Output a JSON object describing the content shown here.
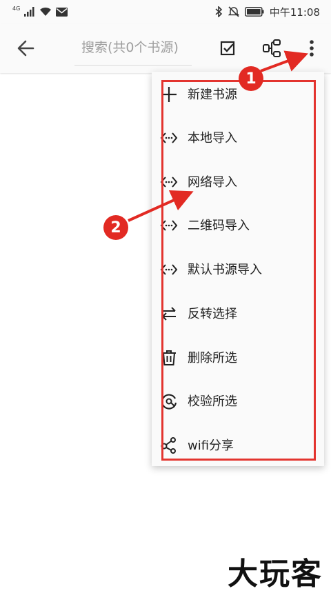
{
  "status_bar": {
    "network_label": "4G",
    "time": "中午11:08",
    "icons": [
      "signal-icon",
      "wifi-icon",
      "mail-icon",
      "bluetooth-icon",
      "mute-icon",
      "battery-icon"
    ]
  },
  "toolbar": {
    "search_placeholder": "搜索(共0个书源)",
    "icons": [
      "back-arrow-icon",
      "select-all-icon",
      "group-icon",
      "more-vert-icon"
    ]
  },
  "menu": {
    "items": [
      {
        "label": "新建书源",
        "icon": "plus-icon"
      },
      {
        "label": "本地导入",
        "icon": "import-icon"
      },
      {
        "label": "网络导入",
        "icon": "import-icon"
      },
      {
        "label": "二维码导入",
        "icon": "import-icon"
      },
      {
        "label": "默认书源导入",
        "icon": "import-icon"
      },
      {
        "label": "反转选择",
        "icon": "swap-icon"
      },
      {
        "label": "删除所选",
        "icon": "trash-icon"
      },
      {
        "label": "校验所选",
        "icon": "check-source-icon"
      },
      {
        "label": "wifi分享",
        "icon": "share-icon"
      }
    ]
  },
  "annotations": {
    "badge_1": "1",
    "badge_2": "2",
    "color": "#e3342f"
  },
  "watermark": "大玩客"
}
